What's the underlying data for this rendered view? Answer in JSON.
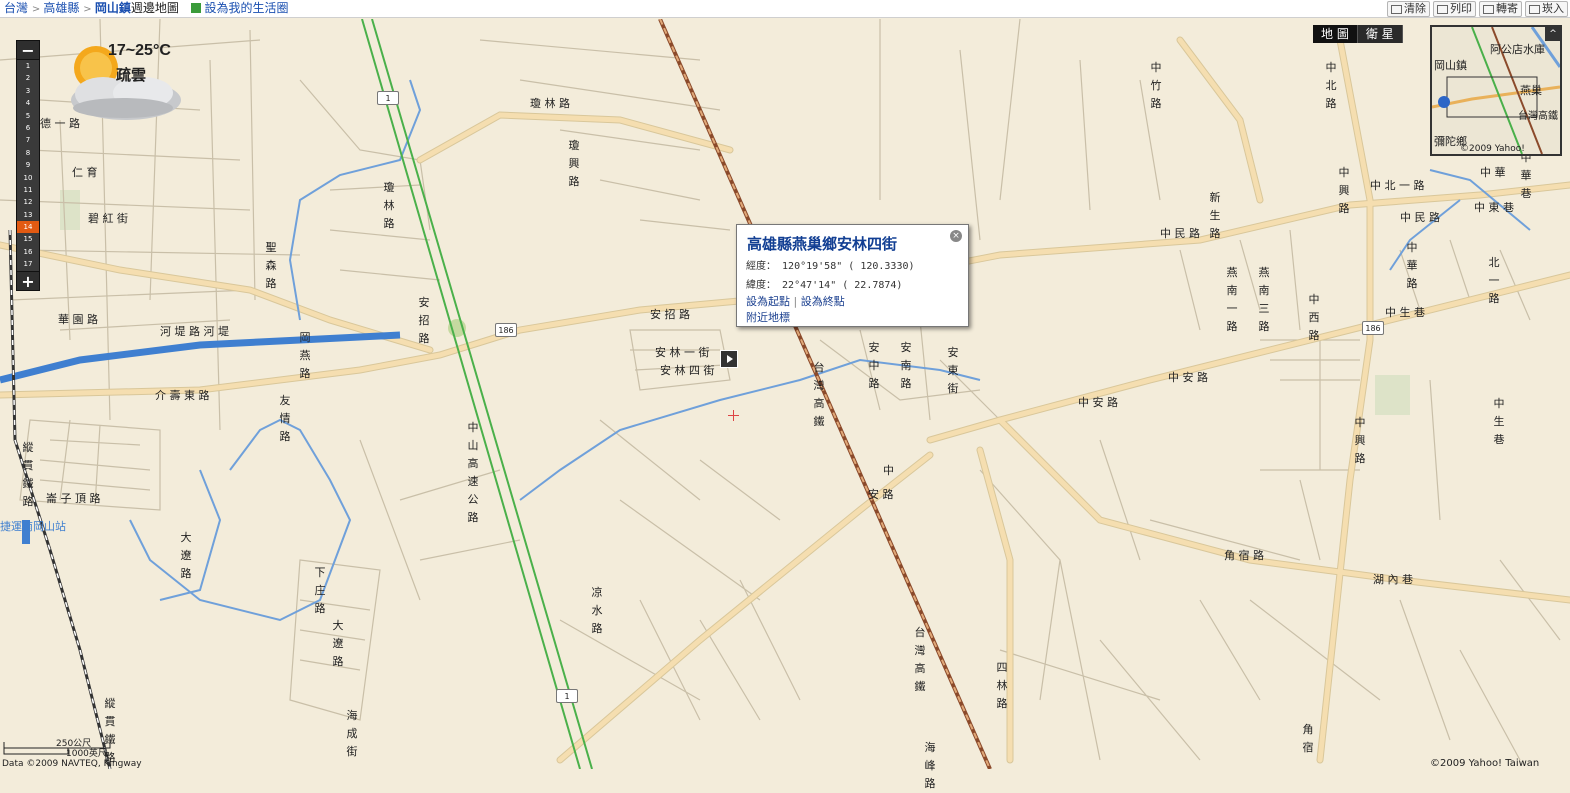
{
  "header": {
    "breadcrumb": [
      "台灣",
      "高雄縣"
    ],
    "current_town": "岡山鎮",
    "current_suffix": "週邊地圖",
    "set_life_circle": "設為我的生活圈"
  },
  "toolbar": {
    "clear": "清除",
    "print": "列印",
    "forward": "轉寄",
    "embed": "崁入"
  },
  "weather": {
    "temperature": "17~25°C",
    "condition": "疏雲",
    "icon": "partly-cloudy-icon"
  },
  "zoom": {
    "levels": [
      "1",
      "2",
      "3",
      "4",
      "5",
      "6",
      "7",
      "8",
      "9",
      "10",
      "11",
      "12",
      "13",
      "14",
      "15",
      "16",
      "17"
    ],
    "active_level": "14",
    "zoom_in": "+",
    "zoom_out": "−"
  },
  "map_type": {
    "map": "地 圖",
    "satellite": "衛 星"
  },
  "overview": {
    "labels": [
      "阿公店水庫",
      "岡山鎮",
      "燕巢",
      "台灣高鐵",
      "彌陀鄉"
    ],
    "copyright": "©2009 Yahoo!",
    "toggle": "^"
  },
  "popup": {
    "title": "高雄縣燕巢鄉安林四街",
    "longitude_label": "經度：",
    "longitude_dms": "120°19'58\"",
    "longitude_dec": "( 120.3330)",
    "latitude_label": "緯度：",
    "latitude_dms": "22°47'14\"",
    "latitude_dec": "(  22.7874)",
    "set_start": "設為起點",
    "set_end": "設為終點",
    "nearby": "附近地標",
    "close": "×"
  },
  "scale": {
    "metric": "250公尺",
    "imperial": "1000英尺"
  },
  "copyright": {
    "left": "Data ©2009 NAVTEQ, Kingway",
    "right": "©2009 Yahoo! Taiwan"
  },
  "map_labels": {
    "horizontal": [
      "德 一 路",
      "仁 育",
      "碧 紅 街",
      "瓊 林 路",
      "華 園 路",
      "河 堤 路 河 堤",
      "介 壽 東 路",
      "安 招 路",
      "安 林 一 街",
      "安 林 四 街",
      "中 民 路",
      "中 安 路",
      "中 民 路",
      "中 安 路",
      "角 宿 路",
      "中 北 一 路",
      "中 民",
      "中 東 巷",
      "中 生 巷",
      "中 華",
      "崙 子 頂 路",
      "湖 內 巷",
      "捷運南岡山站",
      "安 路",
      "中"
    ],
    "vertical": [
      "瓊 興 路",
      "瓊 林 路",
      "聖 森 路",
      "安 招 路",
      "岡 燕 路",
      "友 情 路",
      "中 山 高 速 公 路",
      "台 灣 高 鐵",
      "安 中 路",
      "安 南 路",
      "安 東 街",
      "新 生 路",
      "燕 南 一 路",
      "燕 南 三 路",
      "中 西 路",
      "中 興 路",
      "中 興 路",
      "中 華 路",
      "中 北 路",
      "中 竹 路",
      "凉 水 路",
      "下 庄 路",
      "大 遼 路",
      "大 遼 路",
      "海 成 街",
      "台 灣 高 鐵",
      "海 峰 路",
      "四 林 路",
      "角 宿",
      "縱 貫 鐵 路",
      "縱 貫 鐵 路",
      "中 生 巷",
      "中 華 巷",
      "北 一 路"
    ],
    "route_shields": [
      "1",
      "1",
      "186",
      "186"
    ]
  },
  "colors": {
    "land": "#f3ecda",
    "road": "#fdf6e0",
    "major_road": "#f5deb0",
    "road_outline": "#c9bfa8",
    "river": "#6fa0da",
    "canal": "#3f7fd0",
    "freeway": "#4ab04a",
    "hsr": "#a0522d",
    "popup_title": "#123f93",
    "zoom_active": "#e25a12"
  }
}
